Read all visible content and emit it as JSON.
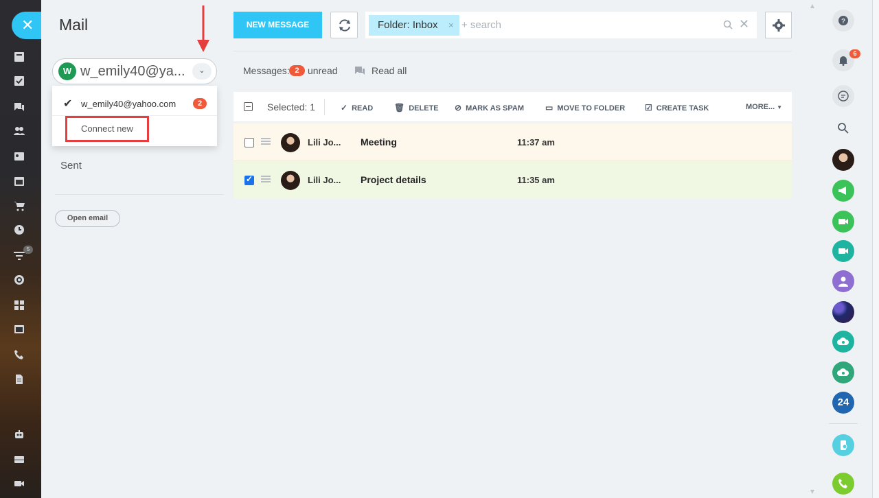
{
  "app": {
    "title": "Mail",
    "close_icon": "close-icon"
  },
  "account": {
    "avatar_letter": "W",
    "name_truncated": "w_emily40@ya...",
    "dropdown": {
      "email": "w_emily40@yahoo.com",
      "unread_count": "2",
      "connect_new": "Connect new"
    }
  },
  "folders": {
    "sent": "Sent",
    "open_email": "Open email"
  },
  "toolbar": {
    "new_message": "NEW MESSAGE",
    "search": {
      "tag": "Folder: Inbox",
      "tag_remove": "×",
      "placeholder": "+ search",
      "clear": "✕"
    }
  },
  "summary": {
    "messages_label": "Messages:",
    "unread_count": "2",
    "unread_label": "unread",
    "read_all": "Read all"
  },
  "actions": {
    "selected": "Selected: 1",
    "read": "READ",
    "delete": "DELETE",
    "mark_as_spam": "MARK AS SPAM",
    "move_to_folder": "MOVE TO FOLDER",
    "create_task": "CREATE TASK",
    "more": "MORE..."
  },
  "messages": [
    {
      "from": "Lili Jo...",
      "subject": "Meeting",
      "time": "11:37 am",
      "checked": false
    },
    {
      "from": "Lili Jo...",
      "subject": "Project details",
      "time": "11:35 am",
      "checked": true
    }
  ],
  "right_bar": {
    "notification_count": "6",
    "bitrix_label": "24"
  },
  "left_bar": {
    "badge_count": "5"
  },
  "colors": {
    "accent": "#2fc6f6",
    "badge_red": "#f05a3a",
    "highlight_red": "#e53e3e",
    "unread_row_bg": "#fdf8eb",
    "selected_row_bg": "#f0f8e4"
  }
}
